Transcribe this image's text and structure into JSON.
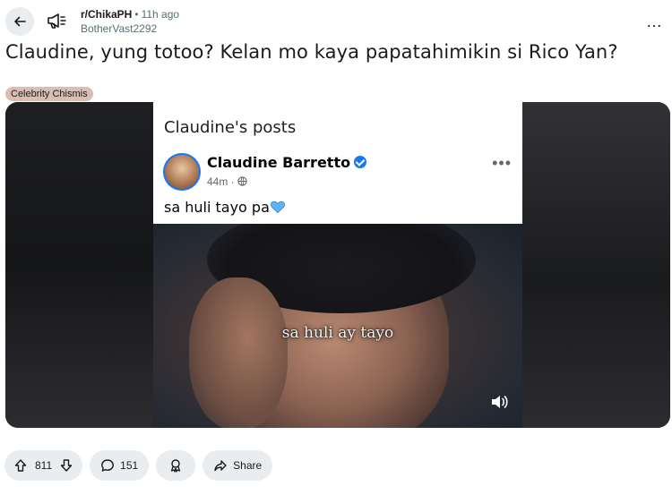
{
  "header": {
    "subreddit": "r/ChikaPH",
    "separator": "•",
    "time_ago": "11h ago",
    "author": "BotherVast2292",
    "more_glyph": "…"
  },
  "post": {
    "title": "Claudine, yung totoo? Kelan mo kaya papatahimikin si Rico Yan?",
    "flair": "Celebrity Chismis"
  },
  "media": {
    "fb_header": "Claudine's posts",
    "fb_name": "Claudine Barretto",
    "fb_time": "44m · ",
    "fb_more": "•••",
    "fb_text": "sa huli tayo pa",
    "video_caption": "sa huli ay tayo"
  },
  "actions": {
    "upvotes": "811",
    "comments": "151",
    "share_label": "Share"
  },
  "colors": {
    "pill_bg": "#eaedef",
    "flair_bg": "#d9bfb3",
    "fb_blue": "#1877f2"
  }
}
